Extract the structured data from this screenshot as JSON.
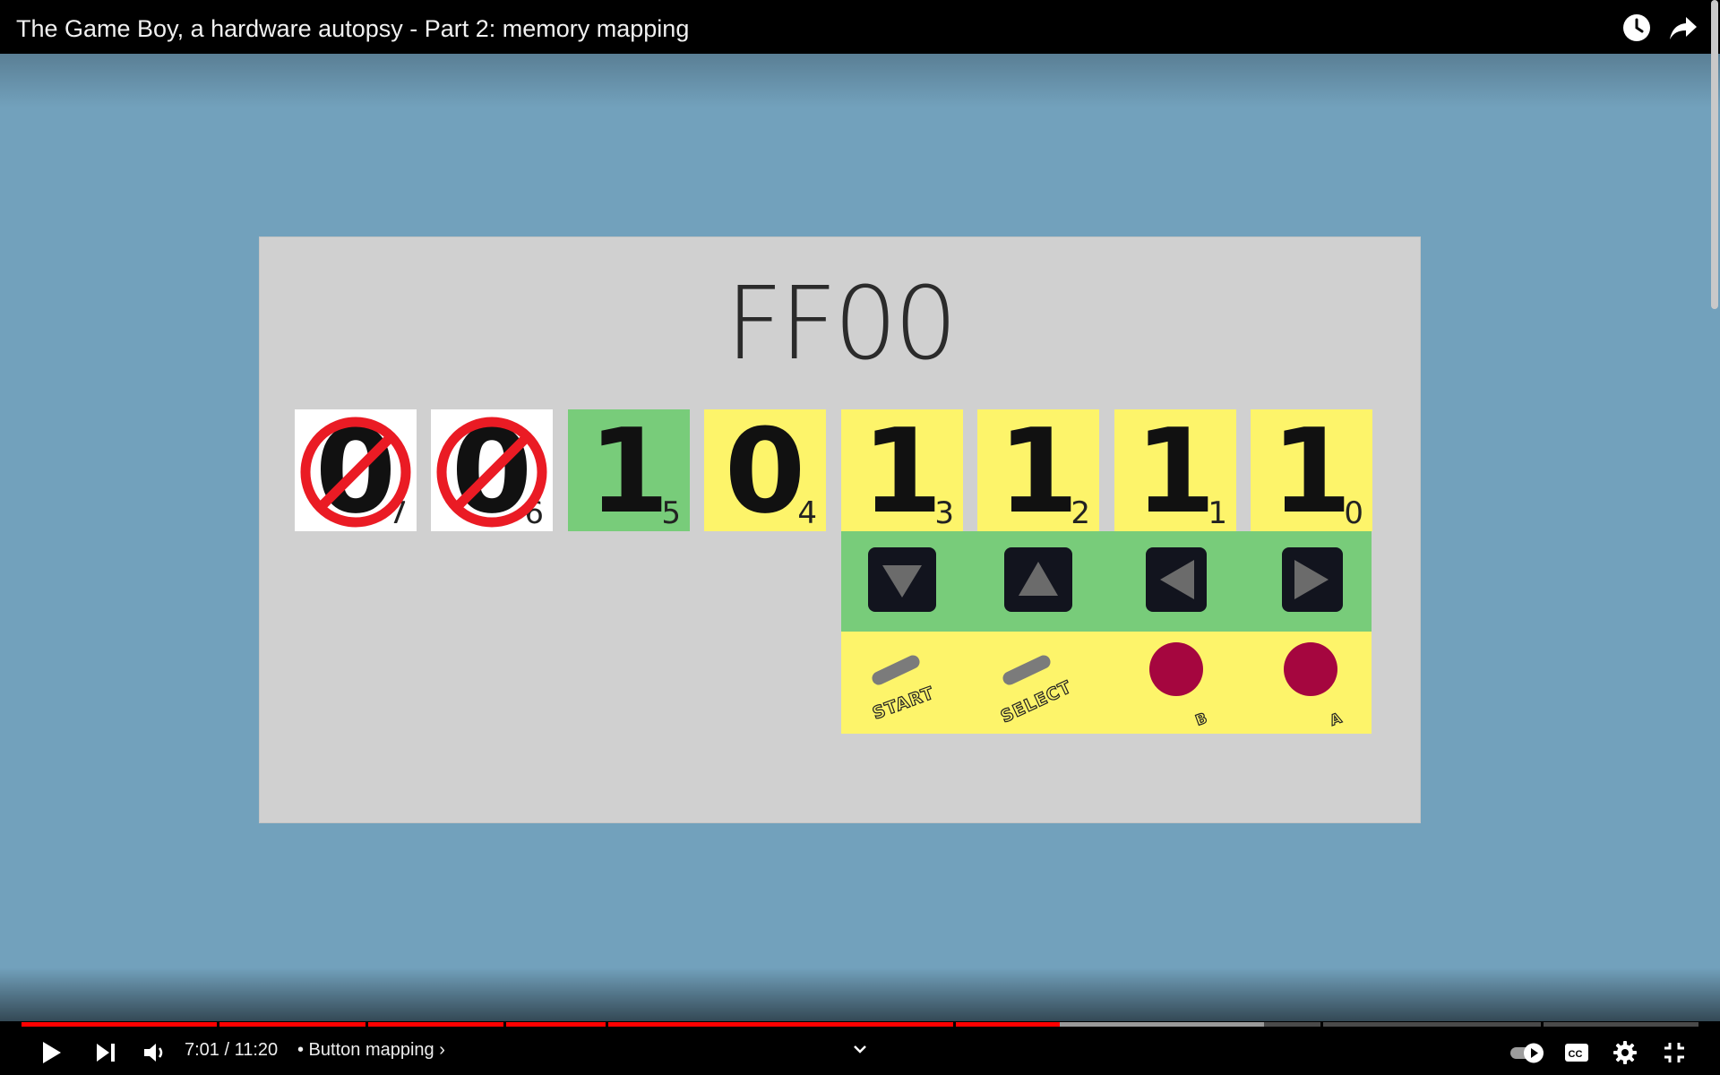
{
  "video": {
    "title": "The Game Boy, a hardware autopsy - Part 2: memory mapping",
    "current_time": "7:01",
    "duration": "11:20",
    "time_display": "7:01 / 11:20",
    "chapter": "• Button mapping ›",
    "progress_fraction": 0.619,
    "buffered_fraction": 0.741
  },
  "icons": {
    "watch_later": "clock-icon",
    "share": "share-arrow-icon",
    "play": "play-icon",
    "next": "next-icon",
    "volume": "volume-icon",
    "expand": "chevron-down-icon",
    "autoplay": "autoplay-toggle-icon",
    "captions": "cc-icon",
    "settings": "gear-icon",
    "fullscreen_exit": "exit-fullscreen-icon"
  },
  "slide": {
    "address": "FF00",
    "bits": [
      {
        "value": "0",
        "index": "7",
        "disabled": true,
        "color": "white"
      },
      {
        "value": "0",
        "index": "6",
        "disabled": true,
        "color": "white"
      },
      {
        "value": "1",
        "index": "5",
        "disabled": false,
        "color": "green"
      },
      {
        "value": "0",
        "index": "4",
        "disabled": false,
        "color": "yellow"
      },
      {
        "value": "1",
        "index": "3",
        "disabled": false,
        "color": "yellow"
      },
      {
        "value": "1",
        "index": "2",
        "disabled": false,
        "color": "yellow"
      },
      {
        "value": "1",
        "index": "1",
        "disabled": false,
        "color": "yellow"
      },
      {
        "value": "1",
        "index": "0",
        "disabled": false,
        "color": "yellow"
      }
    ],
    "dpad": [
      "down-arrow-icon",
      "up-arrow-icon",
      "left-arrow-icon",
      "right-arrow-icon"
    ],
    "buttons": {
      "start": "START",
      "select": "SELECT",
      "b": "B",
      "a": "A"
    }
  },
  "colors": {
    "background": "#72a1bc",
    "slide": "#d0d0d0",
    "yellow": "#fdf46a",
    "green": "#78cc7a",
    "progress": "#ff0000",
    "buffered": "#9a9a9a",
    "button_red": "#a5063f"
  }
}
